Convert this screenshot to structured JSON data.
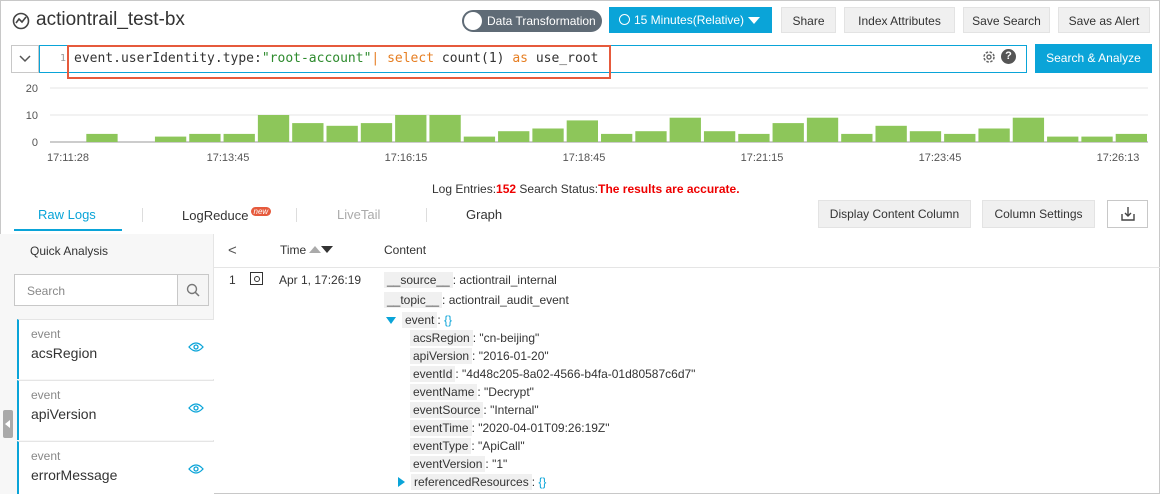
{
  "header": {
    "title": "actiontrail_test-bx",
    "toggle_label": "Data Transformation",
    "time_range": "15 Minutes(Relative)",
    "buttons": [
      "Share",
      "Index Attributes",
      "Save Search",
      "Save as Alert"
    ]
  },
  "query": {
    "line_number": "1",
    "field": "event.userIdentity.type",
    "colon": ":",
    "value": "\"root-account\"",
    "pipe": "|",
    "kw_select": "select",
    "func": "count(1)",
    "kw_as": "as",
    "alias": "use_root",
    "search_button": "Search & Analyze",
    "help": "?"
  },
  "chart_data": {
    "type": "bar",
    "ylim": [
      0,
      20
    ],
    "yticks": [
      "0",
      "10",
      "20"
    ],
    "xtick_labels": [
      "17:11:28",
      "17:13:45",
      "17:16:15",
      "17:18:45",
      "17:21:15",
      "17:23:45",
      "17:26:13"
    ],
    "values": [
      0,
      3,
      0,
      2,
      3,
      3,
      10,
      7,
      6,
      7,
      10,
      10,
      2,
      4,
      5,
      8,
      3,
      4,
      9,
      4,
      3,
      7,
      9,
      3,
      6,
      4,
      3,
      5,
      9,
      2,
      2,
      3
    ],
    "color": "#8dc65a",
    "grid": true
  },
  "status": {
    "entries_label": "Log Entries:",
    "entries_count": "152",
    "search_label": " Search Status:",
    "search_value": "The results are accurate."
  },
  "tabs": {
    "raw": "Raw Logs",
    "logreduce": "LogReduce",
    "new_badge": "new",
    "livetail": "LiveTail",
    "graph": "Graph",
    "display_content": "Display Content Column",
    "column_settings": "Column Settings"
  },
  "quick_analysis": {
    "title": "Quick Analysis",
    "search_placeholder": "Search",
    "fields": [
      {
        "type": "event",
        "name": "acsRegion"
      },
      {
        "type": "event",
        "name": "apiVersion"
      },
      {
        "type": "event",
        "name": "errorMessage"
      }
    ]
  },
  "log_table": {
    "back": "<",
    "time_header": "Time",
    "content_header": "Content",
    "row": {
      "index": "1",
      "time": "Apr 1, 17:26:19",
      "source_key": "__source__",
      "source_val": "actiontrail_internal",
      "topic_key": "__topic__",
      "topic_val": "actiontrail_audit_event",
      "event_key": "event",
      "event_val": "{}",
      "fields": [
        {
          "key": "acsRegion",
          "val": "\"cn-beijing\""
        },
        {
          "key": "apiVersion",
          "val": "\"2016-01-20\""
        },
        {
          "key": "eventId",
          "val": "\"4d48c205-8a02-4566-b4fa-01d80587c6d7\""
        },
        {
          "key": "eventName",
          "val": "\"Decrypt\""
        },
        {
          "key": "eventSource",
          "val": "\"Internal\""
        },
        {
          "key": "eventTime",
          "val": "\"2020-04-01T09:26:19Z\""
        },
        {
          "key": "eventType",
          "val": "\"ApiCall\""
        },
        {
          "key": "eventVersion",
          "val": "\"1\""
        }
      ],
      "ref_key": "referencedResources",
      "ref_val": "{}"
    }
  }
}
